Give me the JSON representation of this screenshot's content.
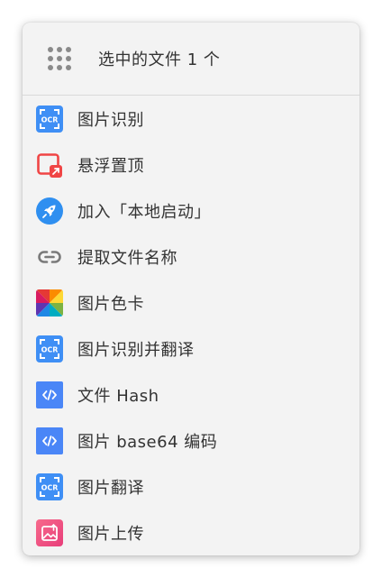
{
  "header": {
    "title": "选中的文件 1 个",
    "grip_icon": "drag-grip-icon"
  },
  "menu": {
    "items": [
      {
        "label": "图片识别",
        "icon": "ocr-icon"
      },
      {
        "label": "悬浮置顶",
        "icon": "pin-window-icon"
      },
      {
        "label": "加入「本地启动」",
        "icon": "rocket-icon"
      },
      {
        "label": "提取文件名称",
        "icon": "link-icon"
      },
      {
        "label": "图片色卡",
        "icon": "color-palette-icon"
      },
      {
        "label": "图片识别并翻译",
        "icon": "ocr-icon"
      },
      {
        "label": "文件 Hash",
        "icon": "code-icon"
      },
      {
        "label": "图片 base64 编码",
        "icon": "code-icon"
      },
      {
        "label": "图片翻译",
        "icon": "ocr-icon"
      },
      {
        "label": "图片上传",
        "icon": "image-upload-icon"
      }
    ]
  },
  "colors": {
    "panel_bg": "#f3f3f3",
    "text": "#333333",
    "ocr_blue": "#3f8ff5",
    "code_blue": "#4a86f7",
    "pin_red": "#f04545",
    "rocket_blue": "#2f8ff0",
    "link_gray": "#7a7a7a",
    "upload_pink": "#f0508a"
  }
}
